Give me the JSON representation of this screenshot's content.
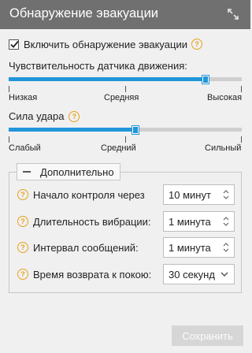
{
  "window": {
    "title": "Обнаружение эвакуации"
  },
  "enable": {
    "label": "Включить обнаружение эвакуации",
    "checked": true
  },
  "motion_sensitivity": {
    "label": "Чувствительность датчика движения:",
    "value_fraction": 0.84,
    "ticks": [
      "Низкая",
      "Средняя",
      "Высокая"
    ]
  },
  "impact_force": {
    "label": "Сила удара",
    "value_fraction": 0.54,
    "ticks": [
      "Слабый",
      "Средний",
      "Сильный"
    ]
  },
  "advanced": {
    "legend": "Дополнительно",
    "rows": [
      {
        "label": "Начало контроля через",
        "value": "10 минут",
        "control": "spinner"
      },
      {
        "label": "Длительность вибрации:",
        "value": "1 минута",
        "control": "spinner"
      },
      {
        "label": "Интервал сообщений:",
        "value": "1 минута",
        "control": "spinner"
      },
      {
        "label": "Время возврата к покою:",
        "value": "30 секунд",
        "control": "dropdown"
      }
    ]
  },
  "save_button": {
    "label": "Сохранить",
    "enabled": false
  },
  "colors": {
    "titlebar": "#707070",
    "accent": "#2196d9",
    "help": "#e8a21a",
    "disabled_button": "#d6d6d6"
  },
  "icons": {
    "expand": "expand-arrows-icon",
    "help": "question-circle-icon"
  }
}
